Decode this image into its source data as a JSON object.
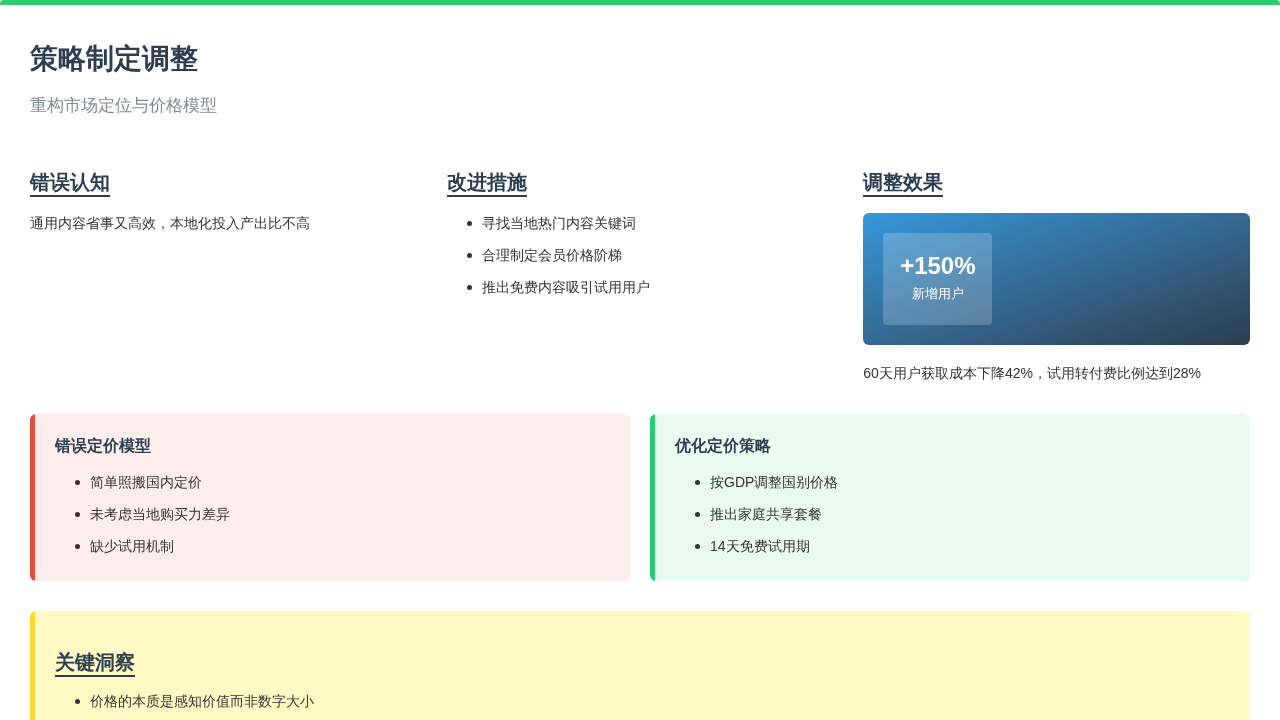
{
  "header": {
    "title": "策略制定调整",
    "subtitle": "重构市场定位与价格模型"
  },
  "columns": [
    {
      "heading": "错误认知",
      "kind": "text",
      "text": "通用内容省事又高效，本地化投入产出比不高"
    },
    {
      "heading": "改进措施",
      "kind": "list",
      "items": [
        "寻找当地热门内容关键词",
        "合理制定会员价格阶梯",
        "推出免费内容吸引试用用户"
      ]
    },
    {
      "heading": "调整效果",
      "kind": "stat",
      "stat": {
        "value": "+150%",
        "label": "新增用户"
      },
      "note": "60天用户获取成本下降42%，试用转付费比例达到28%"
    }
  ],
  "comparison": [
    {
      "title": "错误定价模型",
      "color": "#e74c3c",
      "items": [
        "简单照搬国内定价",
        "未考虑当地购买力差异",
        "缺少试用机制"
      ]
    },
    {
      "title": "优化定价策略",
      "color": "#2ecc71",
      "items": [
        "按GDP调整国别价格",
        "推出家庭共享套餐",
        "14天免费试用期"
      ]
    }
  ],
  "insight": {
    "heading": "关键洞察",
    "color": "#fdd835",
    "items": [
      "价格的本质是感知价值而非数字大小"
    ]
  }
}
